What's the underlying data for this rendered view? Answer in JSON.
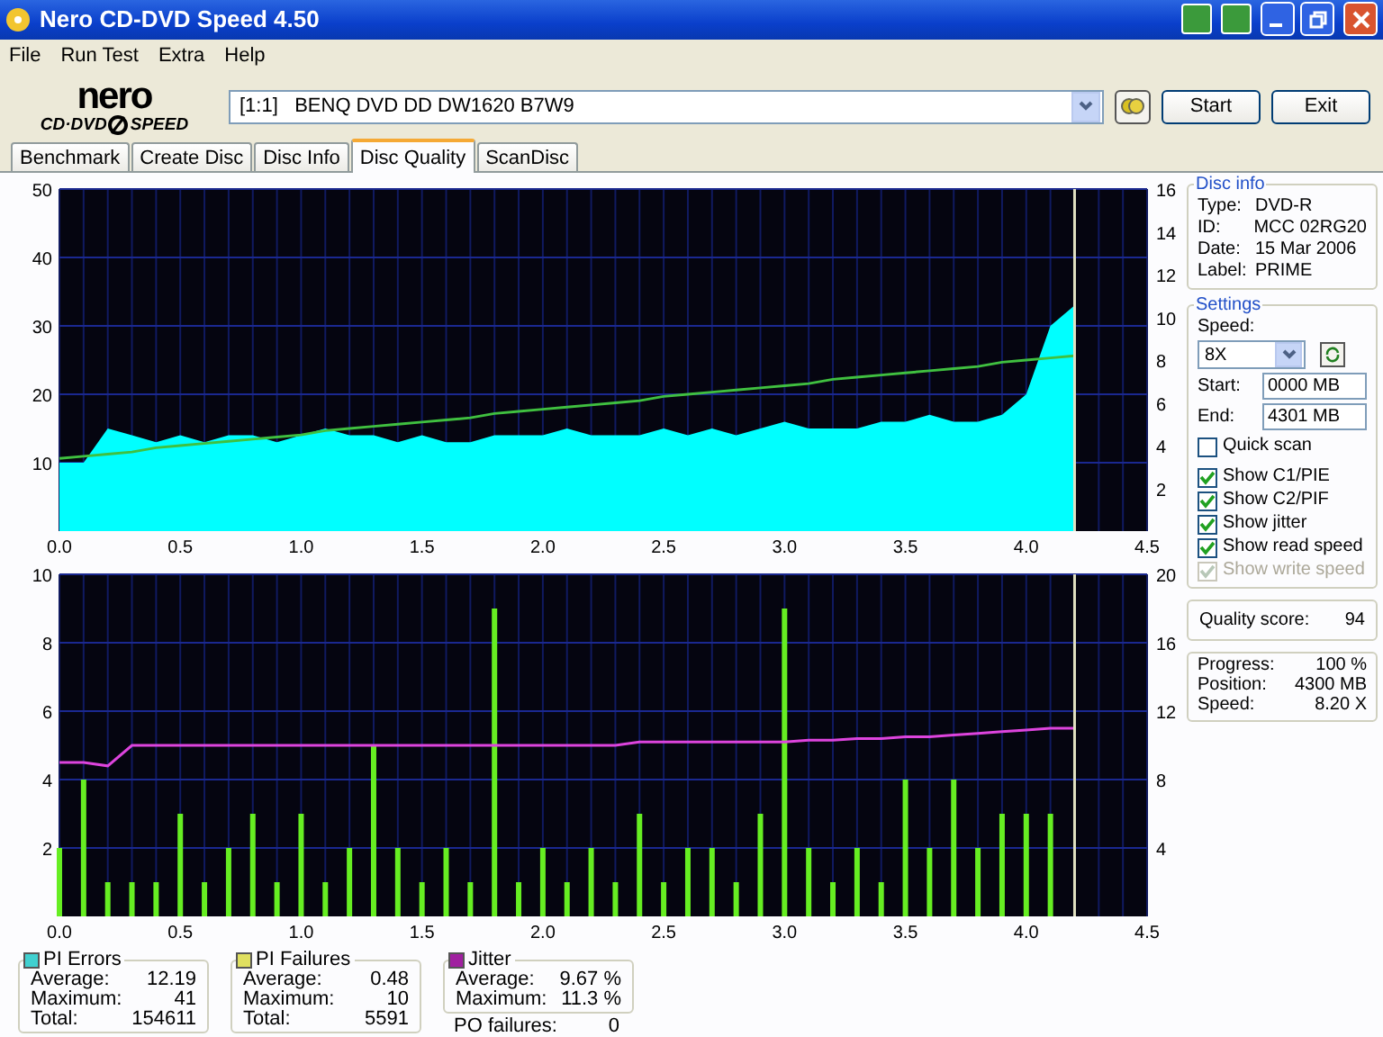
{
  "window": {
    "title": "Nero CD-DVD Speed 4.50"
  },
  "menu": [
    "File",
    "Run Test",
    "Extra",
    "Help"
  ],
  "logo": {
    "name": "nero",
    "left": "CD·DVD",
    "right": "SPEED"
  },
  "drive": {
    "value": "[1:1]   BENQ DVD DD DW1620 B7W9"
  },
  "buttons": [
    "Start",
    "Exit"
  ],
  "tabs": [
    {
      "label": "Benchmark",
      "selected": false
    },
    {
      "label": "Create Disc",
      "selected": false
    },
    {
      "label": "Disc Info",
      "selected": false
    },
    {
      "label": "Disc Quality",
      "selected": true
    },
    {
      "label": "ScanDisc",
      "selected": false
    }
  ],
  "charts": [
    {
      "chart_data": {
        "type": "area",
        "grid": true,
        "ref_lines": [
          {
            "axis": "x",
            "value": 4.2,
            "color": "#e0e0c0"
          }
        ],
        "xlim": [
          0,
          4.5
        ],
        "ylim": [
          0,
          50
        ],
        "y2lim": [
          0,
          16
        ],
        "xticks": [
          {
            "value": 0,
            "label": "0.0"
          },
          {
            "value": 0.5,
            "label": "0.5"
          },
          {
            "value": 1,
            "label": "1.0"
          },
          {
            "value": 1.5,
            "label": "1.5"
          },
          {
            "value": 2,
            "label": "2.0"
          },
          {
            "value": 2.5,
            "label": "2.5"
          },
          {
            "value": 3,
            "label": "3.0"
          },
          {
            "value": 3.5,
            "label": "3.5"
          },
          {
            "value": 4,
            "label": "4.0"
          },
          {
            "value": 4.5,
            "label": "4.5"
          }
        ],
        "yticks": [
          10,
          20,
          30,
          40,
          50
        ],
        "y2ticks": [
          2,
          4,
          6,
          8,
          10,
          12,
          14,
          16
        ],
        "x": [
          0,
          0.1,
          0.2,
          0.3,
          0.4,
          0.5,
          0.6,
          0.7,
          0.8,
          0.9,
          1,
          1.1,
          1.2,
          1.3,
          1.4,
          1.5,
          1.6,
          1.7,
          1.8,
          1.9,
          2,
          2.1,
          2.2,
          2.3,
          2.4,
          2.5,
          2.6,
          2.7,
          2.8,
          2.9,
          3,
          3.1,
          3.2,
          3.3,
          3.4,
          3.5,
          3.6,
          3.7,
          3.8,
          3.9,
          4,
          4.1,
          4.2
        ],
        "series": [
          {
            "color": "#00ffff",
            "values": [
              10,
              10,
              15,
              14,
              13,
              14,
              13,
              14,
              14,
              13,
              14,
              15,
              14,
              14,
              13,
              14,
              13,
              13,
              14,
              14,
              14,
              15,
              14,
              14,
              14,
              15,
              14,
              15,
              14,
              15,
              16,
              15,
              15,
              15,
              16,
              16,
              17,
              16,
              16,
              17,
              20,
              30,
              33
            ]
          },
          {
            "type": "line",
            "axis": "y2",
            "color": "#40c040",
            "values": [
              3.4,
              3.5,
              3.6,
              3.7,
              3.9,
              4.0,
              4.1,
              4.2,
              4.3,
              4.4,
              4.5,
              4.7,
              4.8,
              4.9,
              5.0,
              5.1,
              5.2,
              5.3,
              5.5,
              5.6,
              5.7,
              5.8,
              5.9,
              6.0,
              6.1,
              6.3,
              6.4,
              6.5,
              6.6,
              6.7,
              6.8,
              6.9,
              7.1,
              7.2,
              7.3,
              7.4,
              7.5,
              7.6,
              7.7,
              7.9,
              8.0,
              8.1,
              8.2
            ]
          }
        ]
      }
    },
    {
      "chart_data": {
        "type": "bar",
        "grid": true,
        "ref_lines": [
          {
            "axis": "x",
            "value": 4.2,
            "color": "#e0e0c0"
          }
        ],
        "xlim": [
          0,
          4.5
        ],
        "ylim": [
          0,
          10
        ],
        "y2lim": [
          0,
          20
        ],
        "xticks": [
          {
            "value": 0,
            "label": "0.0"
          },
          {
            "value": 0.5,
            "label": "0.5"
          },
          {
            "value": 1,
            "label": "1.0"
          },
          {
            "value": 1.5,
            "label": "1.5"
          },
          {
            "value": 2,
            "label": "2.0"
          },
          {
            "value": 2.5,
            "label": "2.5"
          },
          {
            "value": 3,
            "label": "3.0"
          },
          {
            "value": 3.5,
            "label": "3.5"
          },
          {
            "value": 4,
            "label": "4.0"
          },
          {
            "value": 4.5,
            "label": "4.5"
          }
        ],
        "yticks": [
          2,
          4,
          6,
          8,
          10
        ],
        "y2ticks": [
          4,
          8,
          12,
          16,
          20
        ],
        "x": [
          0,
          0.1,
          0.2,
          0.3,
          0.4,
          0.5,
          0.6,
          0.7,
          0.8,
          0.9,
          1,
          1.1,
          1.2,
          1.3,
          1.4,
          1.5,
          1.6,
          1.7,
          1.8,
          1.9,
          2,
          2.1,
          2.2,
          2.3,
          2.4,
          2.5,
          2.6,
          2.7,
          2.8,
          2.9,
          3,
          3.1,
          3.2,
          3.3,
          3.4,
          3.5,
          3.6,
          3.7,
          3.8,
          3.9,
          4,
          4.1,
          4.2
        ],
        "series": [
          {
            "color": "#66ee22",
            "values": [
              2,
              4,
              1,
              1,
              1,
              3,
              1,
              2,
              3,
              1,
              3,
              1,
              2,
              5,
              2,
              1,
              2,
              1,
              9,
              1,
              2,
              1,
              2,
              1,
              3,
              1,
              2,
              2,
              1,
              3,
              9,
              2,
              1,
              2,
              1,
              4,
              2,
              4,
              2,
              3,
              3,
              3,
              null
            ]
          },
          {
            "type": "line",
            "axis": "y2",
            "color": "#dd44dd",
            "values": [
              9,
              9,
              8.8,
              10,
              10,
              10,
              10,
              10,
              10,
              10,
              10,
              10,
              10,
              10,
              10,
              10,
              10,
              10,
              10,
              10,
              10,
              10,
              10,
              10,
              10.2,
              10.2,
              10.2,
              10.2,
              10.2,
              10.2,
              10.2,
              10.3,
              10.3,
              10.4,
              10.4,
              10.5,
              10.5,
              10.6,
              10.7,
              10.8,
              10.9,
              11,
              11
            ]
          }
        ]
      }
    }
  ],
  "disc_info": {
    "title": "Disc info",
    "rows": [
      {
        "label": "Type:",
        "value": "DVD-R"
      },
      {
        "label": "ID:",
        "value": "MCC 02RG20"
      },
      {
        "label": "Date:",
        "value": "15 Mar 2006"
      },
      {
        "label": "Label:",
        "value": "PRIME"
      }
    ]
  },
  "settings": {
    "title": "Settings",
    "speed_label": "Speed:",
    "speed": "8X",
    "start_label": "Start:",
    "start": "0000 MB",
    "end_label": "End:",
    "end": "4301 MB",
    "options": [
      {
        "label": "Quick scan",
        "checked": false,
        "disabled": false
      },
      {
        "label": "Show C1/PIE",
        "checked": true,
        "disabled": false
      },
      {
        "label": "Show C2/PIF",
        "checked": true,
        "disabled": false
      },
      {
        "label": "Show jitter",
        "checked": true,
        "disabled": false
      },
      {
        "label": "Show read speed",
        "checked": true,
        "disabled": false
      },
      {
        "label": "Show write speed",
        "checked": true,
        "disabled": true
      }
    ]
  },
  "quality": {
    "label": "Quality score:",
    "value": "94"
  },
  "progress": [
    {
      "label": "Progress:",
      "value": "100 %"
    },
    {
      "label": "Position:",
      "value": "4300 MB"
    },
    {
      "label": "Speed:",
      "value": "8.20 X"
    }
  ],
  "stats": [
    {
      "title": "PI Errors",
      "color": "#40d0d0",
      "rows": [
        {
          "label": "Average:",
          "value": "12.19"
        },
        {
          "label": "Maximum:",
          "value": "41"
        },
        {
          "label": "Total:",
          "value": "154611"
        }
      ]
    },
    {
      "title": "PI Failures",
      "color": "#e0e060",
      "rows": [
        {
          "label": "Average:",
          "value": "0.48"
        },
        {
          "label": "Maximum:",
          "value": "10"
        },
        {
          "label": "Total:",
          "value": "5591"
        }
      ]
    },
    {
      "title": "Jitter",
      "color": "#a020a0",
      "rows": [
        {
          "label": "Average:",
          "value": "9.67 %"
        },
        {
          "label": "Maximum:",
          "value": "11.3 %"
        }
      ]
    }
  ],
  "po_failures": {
    "label": "PO failures:",
    "value": "0"
  }
}
